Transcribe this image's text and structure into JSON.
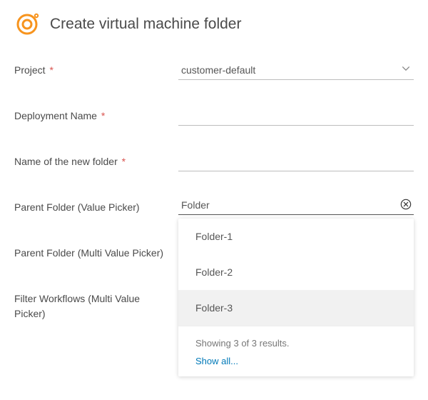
{
  "header": {
    "title": "Create virtual machine folder"
  },
  "form": {
    "project": {
      "label": "Project",
      "required_mark": "*",
      "value": "customer-default"
    },
    "deployment_name": {
      "label": "Deployment Name",
      "required_mark": "*",
      "value": ""
    },
    "new_folder_name": {
      "label": "Name of the new folder",
      "required_mark": "*",
      "value": ""
    },
    "parent_folder": {
      "label": "Parent Folder (Value Picker)",
      "input_value": "Folder",
      "dropdown": {
        "items": [
          "Folder-1",
          "Folder-2",
          "Folder-3"
        ],
        "results_text": "Showing 3 of 3 results.",
        "show_all": "Show all..."
      }
    },
    "parent_folder_multi": {
      "label": "Parent Folder (Multi Value Picker)"
    },
    "filter_workflows": {
      "label": "Filter Workflows (Multi Value Picker)"
    }
  }
}
